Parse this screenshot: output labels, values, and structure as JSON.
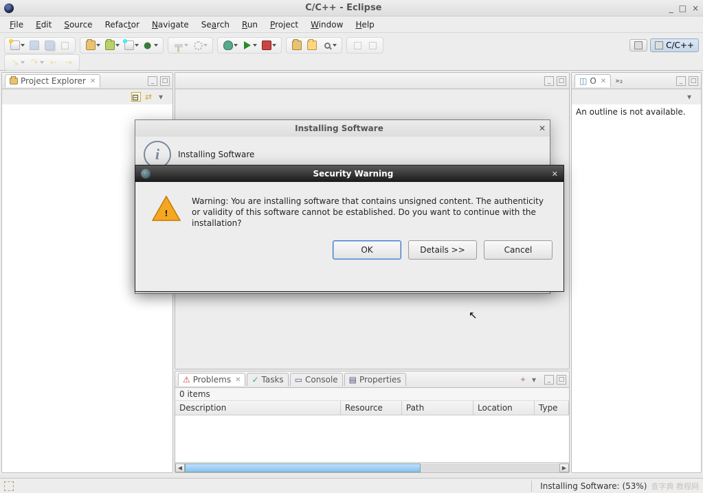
{
  "window": {
    "title": "C/C++ - Eclipse"
  },
  "menubar": [
    "File",
    "Edit",
    "Source",
    "Refactor",
    "Navigate",
    "Search",
    "Run",
    "Project",
    "Window",
    "Help"
  ],
  "perspective": {
    "label": "C/C++"
  },
  "views": {
    "project_explorer": {
      "title": "Project Explorer"
    },
    "editor": {},
    "outline": {
      "title": "O",
      "next_tab": "»₂",
      "message": "An outline is not available."
    },
    "problems": {
      "tabs": [
        "Problems",
        "Tasks",
        "Console",
        "Properties"
      ],
      "items_text": "0 items",
      "columns": [
        "Description",
        "Resource",
        "Path",
        "Location",
        "Type"
      ]
    }
  },
  "dialogs": {
    "install": {
      "title": "Installing Software",
      "heading": "Installing Software"
    },
    "security": {
      "title": "Security Warning",
      "message": "Warning: You are installing software that contains unsigned content. The authenticity or validity of this software cannot be established. Do you want to continue with the installation?",
      "buttons": {
        "ok": "OK",
        "details": "Details >>",
        "cancel": "Cancel"
      }
    }
  },
  "status": {
    "progress_text": "Installing Software: (53%)",
    "watermark": "查字典 教程网"
  }
}
